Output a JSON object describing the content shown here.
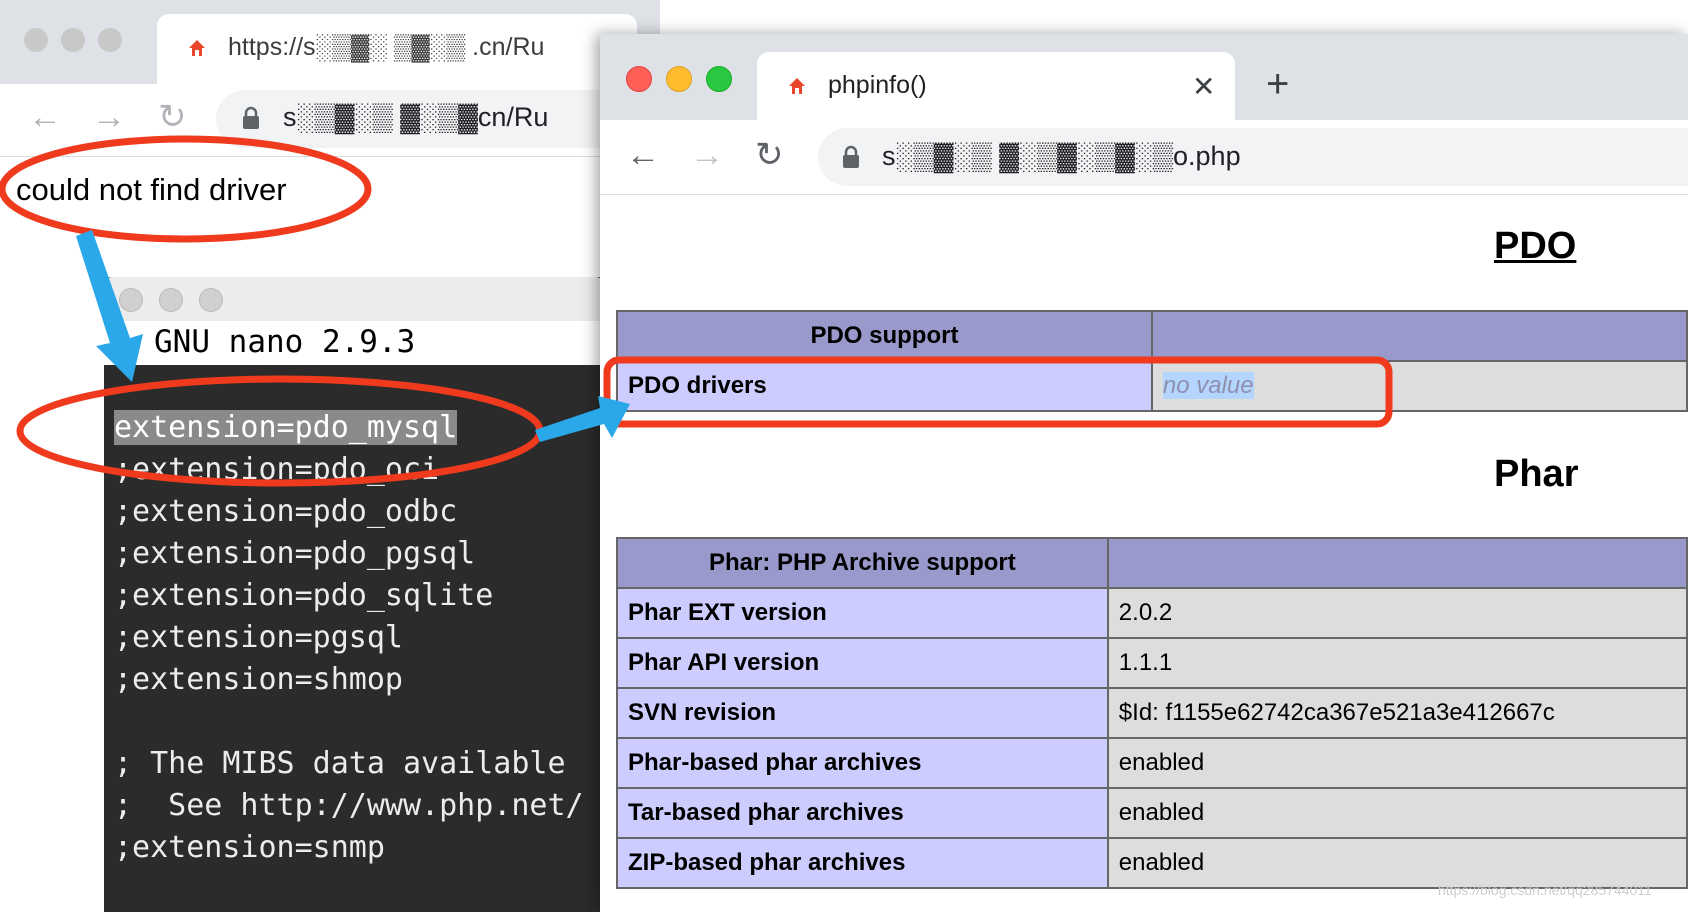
{
  "back_browser": {
    "tab_title": "https://s░▒▓░ ▒▓░▒ .cn/Ru",
    "url": "s░▒▓░▒ ▓░▒▓cn/Ru",
    "error_text": "could not find driver"
  },
  "terminal": {
    "title": "GNU nano 2.9.3",
    "lines": [
      "extension=pdo_mysql",
      ";extension=pdo_oci",
      ";extension=pdo_odbc",
      ";extension=pdo_pgsql",
      ";extension=pdo_sqlite",
      ";extension=pgsql",
      ";extension=shmop",
      "",
      "; The MIBS data available",
      ";  See http://www.php.net/",
      ";extension=snmp"
    ]
  },
  "front_browser": {
    "tab_title": "phpinfo()",
    "url": "s░▒▓░▒ ▓░▒▓░▒▓░▒o.php",
    "close_glyph": "✕",
    "new_tab_glyph": "+"
  },
  "pdo": {
    "heading": "PDO",
    "header_label": "PDO support",
    "rows": [
      {
        "label": "PDO drivers",
        "value": "no value"
      }
    ]
  },
  "phar": {
    "heading": "Phar",
    "header_label": "Phar: PHP Archive support",
    "rows": [
      {
        "label": "Phar EXT version",
        "value": "2.0.2"
      },
      {
        "label": "Phar API version",
        "value": "1.1.1"
      },
      {
        "label": "SVN revision",
        "value": "$Id: f1155e62742ca367e521a3e412667c"
      },
      {
        "label": "Phar-based phar archives",
        "value": "enabled"
      },
      {
        "label": "Tar-based phar archives",
        "value": "enabled"
      },
      {
        "label": "ZIP-based phar archives",
        "value": "enabled"
      }
    ]
  },
  "watermark": "https://blog.csdn.net/qq285744011",
  "colors": {
    "annotation_red": "#f03a1e",
    "annotation_blue": "#2aa8ea",
    "php_header": "#9999cc",
    "php_label": "#ccccff",
    "php_value": "#dddddd"
  },
  "icons": [
    "favicon-icon",
    "back-arrow-icon",
    "forward-arrow-icon",
    "reload-icon",
    "lock-icon",
    "close-icon",
    "new-tab-icon"
  ]
}
